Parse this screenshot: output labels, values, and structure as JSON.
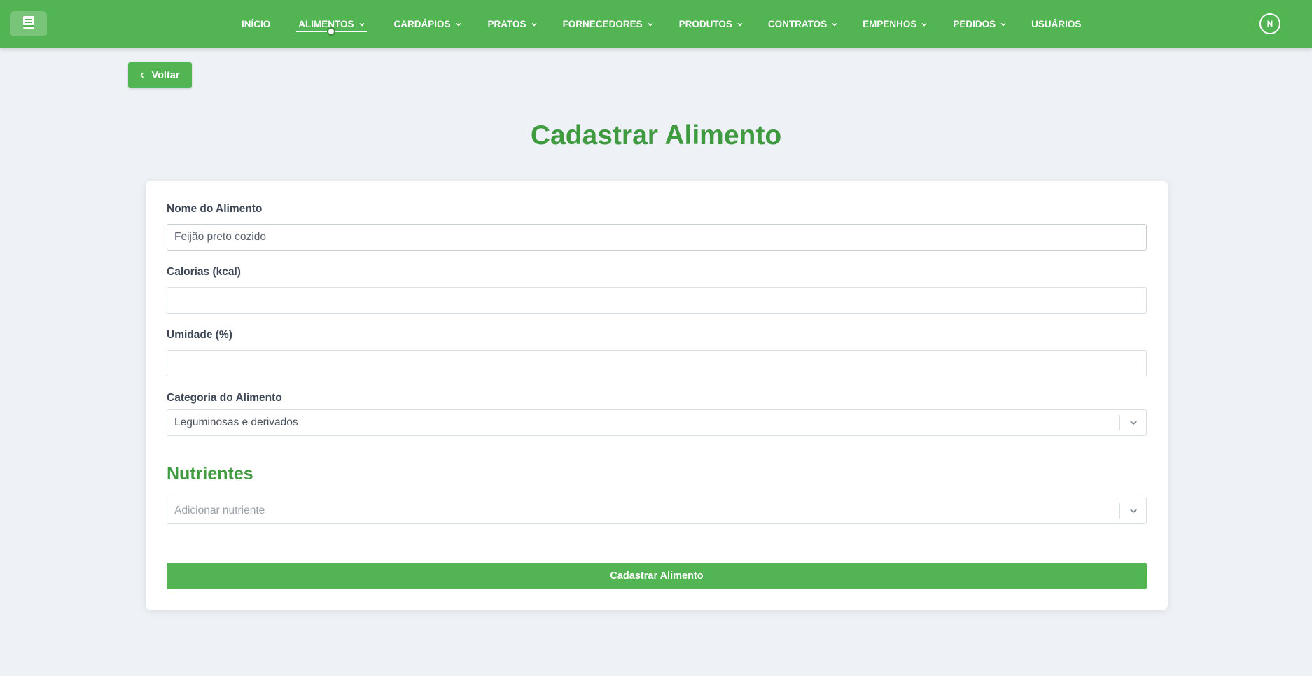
{
  "header": {
    "nav": [
      {
        "label": "INÍCIO",
        "dropdown": false,
        "active": false
      },
      {
        "label": "ALIMENTOS",
        "dropdown": true,
        "active": true
      },
      {
        "label": "CARDÁPIOS",
        "dropdown": true,
        "active": false
      },
      {
        "label": "PRATOS",
        "dropdown": true,
        "active": false
      },
      {
        "label": "FORNECEDORES",
        "dropdown": true,
        "active": false
      },
      {
        "label": "PRODUTOS",
        "dropdown": true,
        "active": false
      },
      {
        "label": "CONTRATOS",
        "dropdown": true,
        "active": false
      },
      {
        "label": "EMPENHOS",
        "dropdown": true,
        "active": false
      },
      {
        "label": "PEDIDOS",
        "dropdown": true,
        "active": false
      },
      {
        "label": "USUÁRIOS",
        "dropdown": false,
        "active": false
      }
    ],
    "avatar_initial": "N",
    "logo_icon": "book-icon"
  },
  "back_button": {
    "label": "Voltar"
  },
  "page_title": "Cadastrar Alimento",
  "form": {
    "name": {
      "label": "Nome do Alimento",
      "value": "Feijão preto cozido"
    },
    "calories": {
      "label": "Calorias (kcal)",
      "value": ""
    },
    "humidity": {
      "label": "Umidade (%)",
      "value": ""
    },
    "category": {
      "label": "Categoria do Alimento",
      "selected": "Leguminosas e derivados"
    },
    "nutrients_title": "Nutrientes",
    "nutrients_select": {
      "placeholder": "Adicionar nutriente"
    },
    "submit_label": "Cadastrar Alimento"
  },
  "colors": {
    "primary": "#52b453",
    "title_green": "#3f9a40",
    "background": "#eef2f6"
  }
}
